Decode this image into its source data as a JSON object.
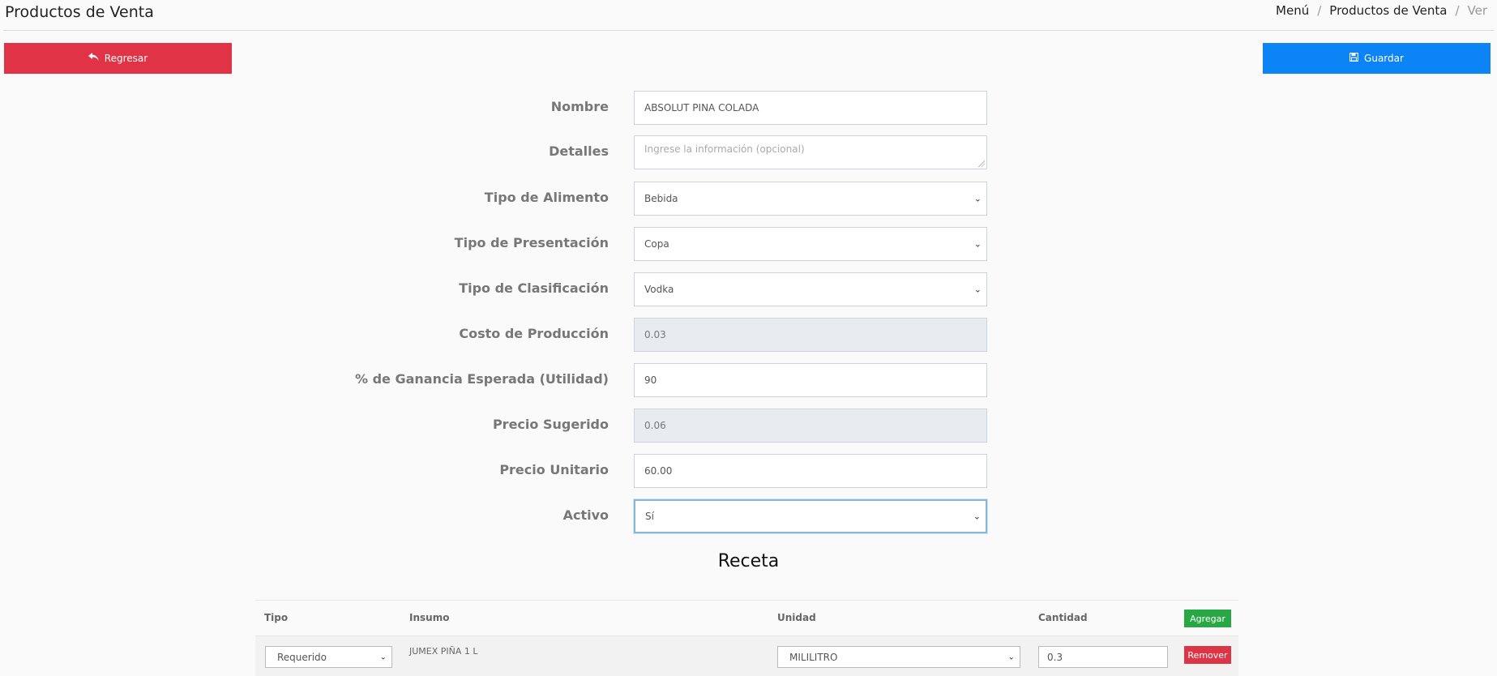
{
  "header": {
    "title": "Productos de Venta",
    "breadcrumb": [
      "Menú",
      "Productos de Venta",
      "Ver"
    ]
  },
  "toolbar": {
    "back_label": "Regresar",
    "save_label": "Guardar"
  },
  "form": {
    "nombre": {
      "label": "Nombre",
      "value": "ABSOLUT  PINA COLADA"
    },
    "detalles": {
      "label": "Detalles",
      "placeholder": "Ingrese la información (opcional)"
    },
    "tipo_alimento": {
      "label": "Tipo de Alimento",
      "value": "Bebida"
    },
    "tipo_presentacion": {
      "label": "Tipo de Presentación",
      "value": "Copa"
    },
    "tipo_clasificacion": {
      "label": "Tipo de Clasificación",
      "value": "Vodka"
    },
    "costo_produccion": {
      "label": "Costo de Producción",
      "value": "0.03"
    },
    "ganancia": {
      "label": "% de Ganancia Esperada (Utilidad)",
      "value": "90"
    },
    "precio_sugerido": {
      "label": "Precio Sugerido",
      "value": "0.06"
    },
    "precio_unitario": {
      "label": "Precio Unitario",
      "value": "60.00"
    },
    "activo": {
      "label": "Activo",
      "value": "Sí"
    }
  },
  "recipe": {
    "title": "Receta",
    "columns": [
      "Tipo",
      "Insumo",
      "Unidad",
      "Cantidad"
    ],
    "add_label": "Agregar",
    "rows": [
      {
        "tipo": "Requerido",
        "insumo": "JUMEX PIÑA 1 L",
        "unidad": "MILILITRO",
        "cantidad": "0.3",
        "remove_label": "Remover"
      }
    ]
  }
}
